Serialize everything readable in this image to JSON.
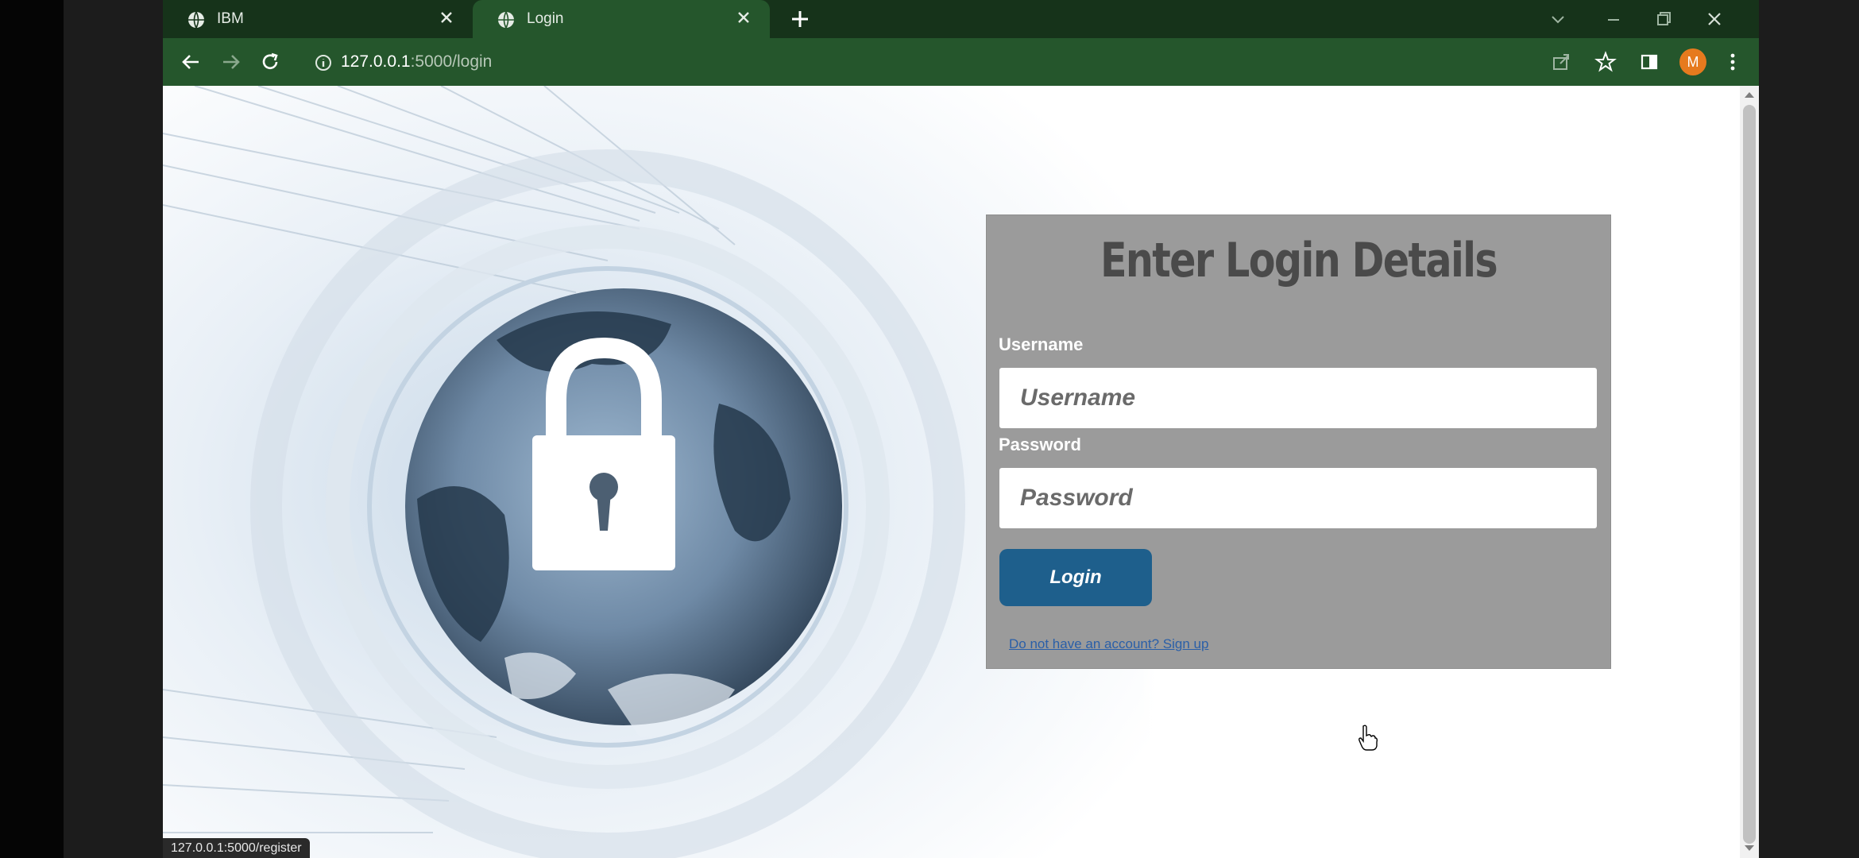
{
  "browser": {
    "tabs": [
      {
        "label": "IBM",
        "active": false
      },
      {
        "label": "Login",
        "active": true
      }
    ],
    "url": {
      "host": "127.0.0.1",
      "path": ":5000/login"
    },
    "avatar_letter": "M",
    "status_url": "127.0.0.1:5000/register",
    "colors": {
      "tabstrip": "#16331a",
      "toolbar": "#25562c",
      "avatar": "#e67a1e"
    }
  },
  "login": {
    "title": "Enter Login Details",
    "username_label": "Username",
    "username_placeholder": "Username",
    "password_label": "Password",
    "password_placeholder": "Password",
    "button_label": "Login",
    "signup_text": "Do not have an account? Sign up",
    "colors": {
      "panel": "#9b9b9b",
      "button": "#1e5f8c"
    }
  },
  "hero": {
    "icon": "padlock-globe-icon"
  }
}
